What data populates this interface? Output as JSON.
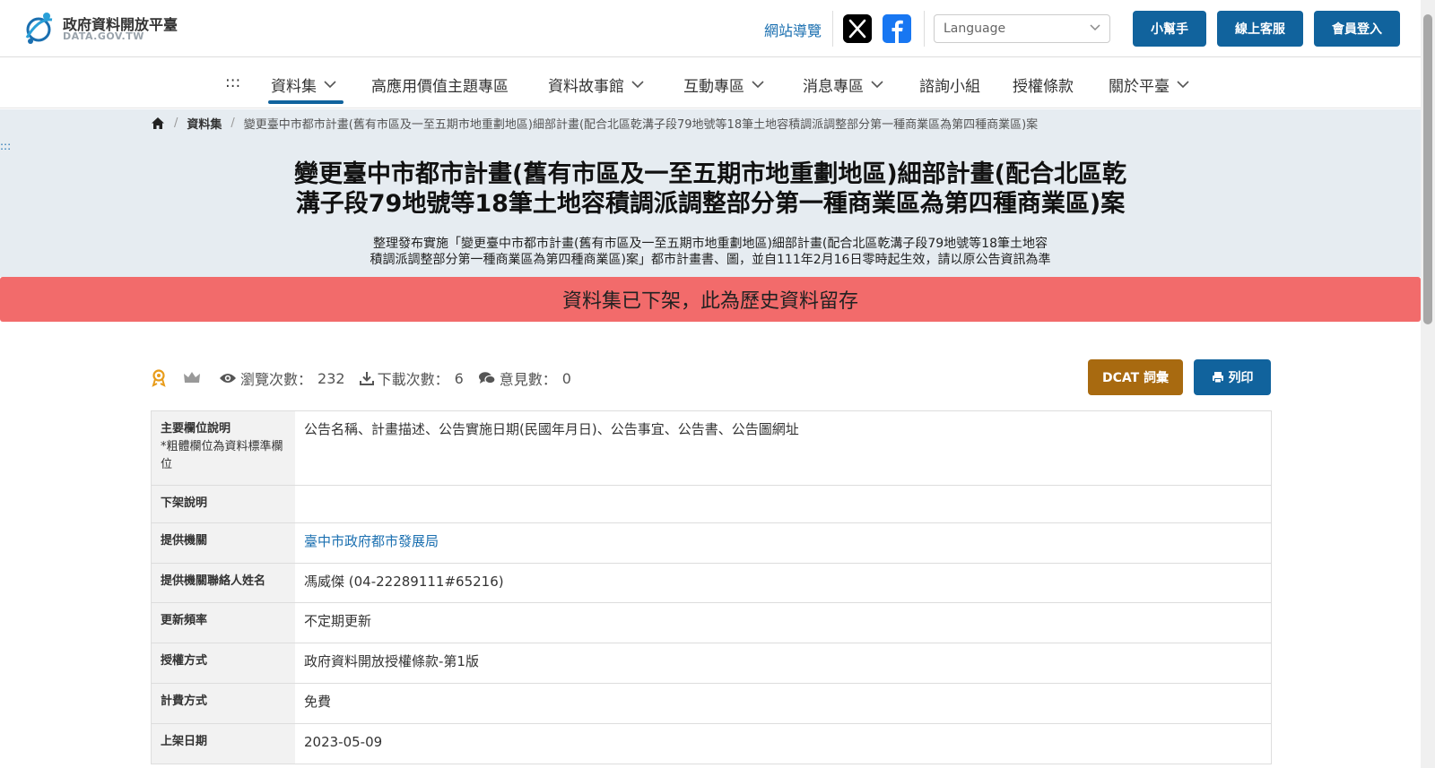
{
  "header": {
    "logo_title": "政府資料開放平臺",
    "logo_sub": "DATA.GOV.TW",
    "sitemap": "網站導覽",
    "language_placeholder": "Language",
    "buttons": [
      "小幫手",
      "線上客服",
      "會員登入"
    ]
  },
  "nav": {
    "skip": ":::",
    "items": [
      "資料集",
      "高應用價值主題專區",
      "資料故事館",
      "互動專區",
      "消息專區",
      "諮詢小組",
      "授權條款",
      "關於平臺"
    ]
  },
  "breadcrumb": {
    "level1": "資料集",
    "current": "變更臺中市都市計畫(舊有市區及一至五期市地重劃地區)細部計畫(配合北區乾溝子段79地號等18筆土地容積調派調整部分第一種商業區為第四種商業區)案"
  },
  "hero": {
    "skip": ":::",
    "title_line1": "變更臺中市都市計畫(舊有市區及一至五期市地重劃地區)細部計畫(配合北區乾",
    "title_line2": "溝子段79地號等18筆土地容積調派調整部分第一種商業區為第四種商業區)案",
    "desc_line1": "整理發布實施「變更臺中市都市計畫(舊有市區及一至五期市地重劃地區)細部計畫(配合北區乾溝子段79地號等18筆土地容",
    "desc_line2": "積調派調整部分第一種商業區為第四種商業區)案」都市計畫書、圖，並自111年2月16日零時起生效，請以原公告資訊為準",
    "offline_notice": "資料集已下架，此為歷史資料留存"
  },
  "stats": {
    "views_label": "瀏覽次數：",
    "views": "232",
    "downloads_label": "下載次數：",
    "downloads": "6",
    "comments_label": "意見數：",
    "comments": "0"
  },
  "actions": {
    "dcat": "DCAT 詞彙",
    "print": "列印"
  },
  "details": [
    {
      "key": "主要欄位說明",
      "note": "*粗體欄位為資料標準欄位",
      "value": "公告名稱、計畫描述、公告實施日期(民國年月日)、公告事宜、公告書、公告圖網址"
    },
    {
      "key": "下架說明",
      "value": ""
    },
    {
      "key": "提供機關",
      "value": "臺中市政府都市發展局",
      "link": true
    },
    {
      "key": "提供機關聯絡人姓名",
      "value": "馮威傑 (04-22289111#65216)"
    },
    {
      "key": "更新頻率",
      "value": "不定期更新"
    },
    {
      "key": "授權方式",
      "value": "政府資料開放授權條款-第1版"
    },
    {
      "key": "計費方式",
      "value": "免費"
    },
    {
      "key": "上架日期",
      "value": "2023-05-09"
    }
  ],
  "colors": {
    "primary": "#11639d",
    "dcat": "#a86a10",
    "offline": "#f26b6b",
    "hero_bg": "#e6ecf1"
  }
}
